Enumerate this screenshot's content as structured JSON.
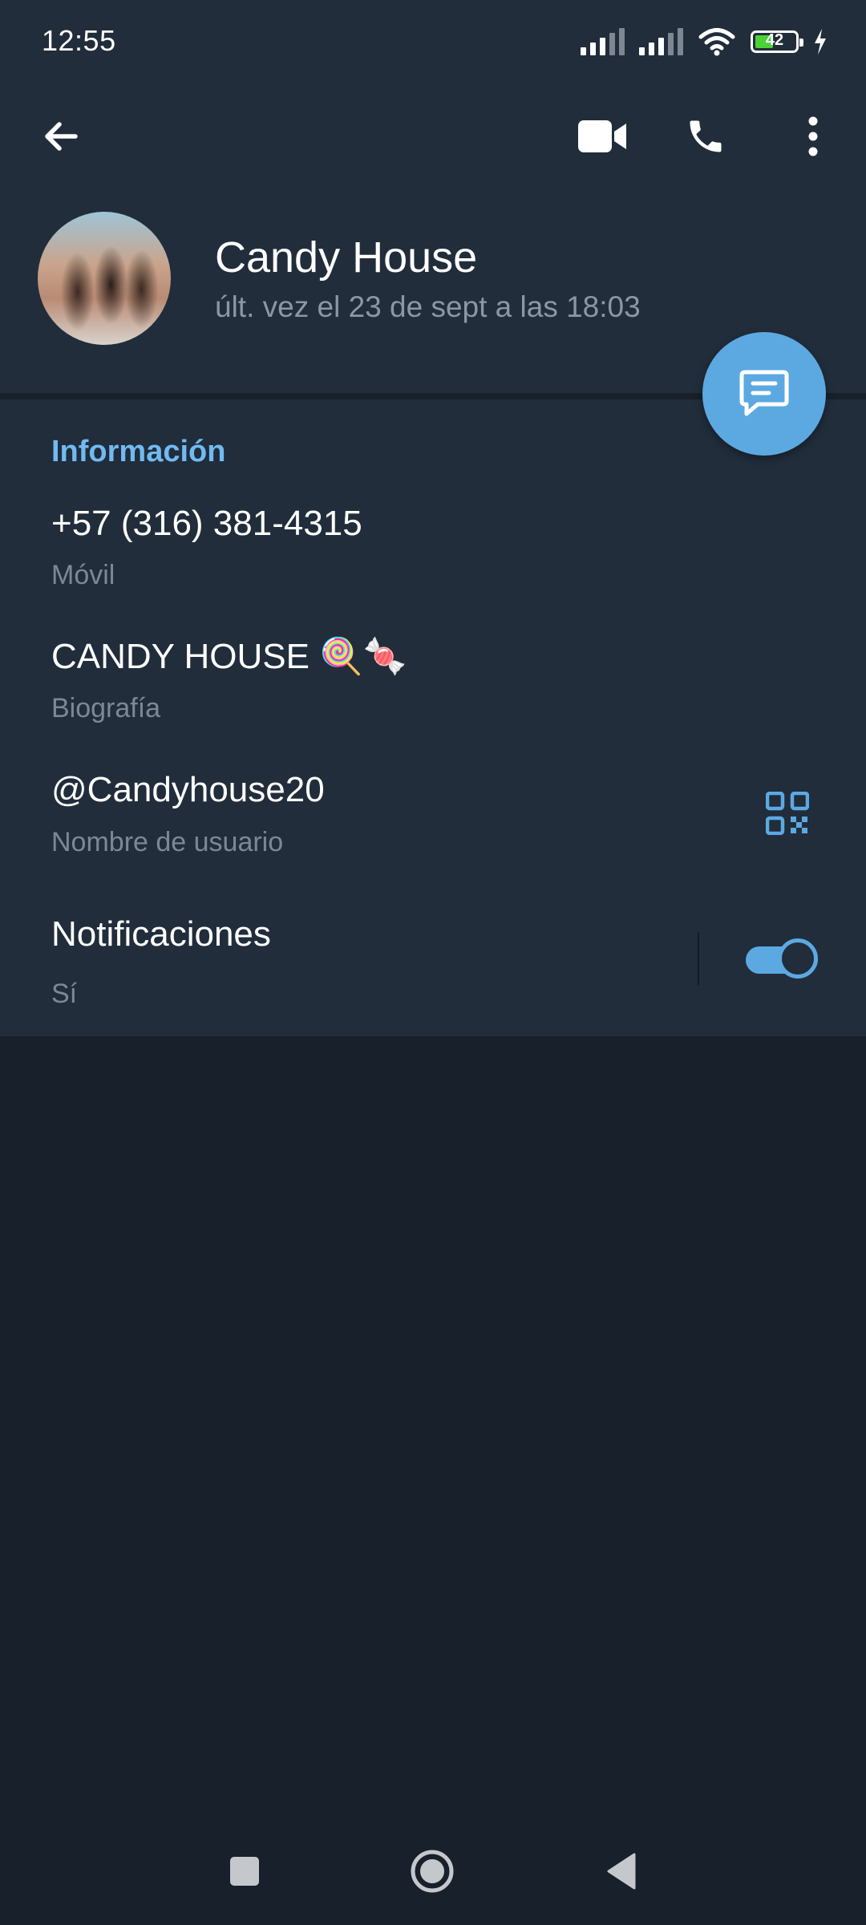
{
  "status_bar": {
    "time": "12:55",
    "battery_level": "42",
    "battery_fraction": 0.42,
    "icons": [
      "signal-icon",
      "signal-icon",
      "wifi-icon",
      "battery-icon",
      "charging-icon"
    ]
  },
  "toolbar": {
    "icons": [
      "back-arrow-icon",
      "video-call-icon",
      "phone-icon",
      "more-vert-icon"
    ]
  },
  "profile": {
    "name": "Candy House",
    "last_seen": "últ. vez el 23 de sept a las 18:03"
  },
  "info": {
    "section_title": "Información",
    "phone": {
      "value": "+57 (316) 381-4315",
      "label": "Móvil"
    },
    "bio": {
      "value": "CANDY HOUSE 🍭🍬",
      "label": "Biografía"
    },
    "username": {
      "value": "@Candyhouse20",
      "label": "Nombre de usuario"
    },
    "notifications": {
      "value": "Notificaciones",
      "label": "Sí",
      "enabled": true
    }
  },
  "colors": {
    "accent": "#5ca9e2",
    "section_title": "#71baf2",
    "header_bg": "#212d3b",
    "page_bg": "#17202b",
    "secondary_text": "#7c8895"
  },
  "nav_bar": {
    "icons": [
      "recents-square-icon",
      "home-circle-icon",
      "back-triangle-icon"
    ]
  }
}
